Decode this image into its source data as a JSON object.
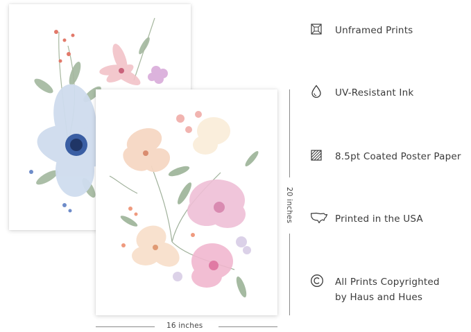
{
  "dimensions": {
    "width_label": "16 inches",
    "height_label": "20 inches"
  },
  "features": [
    {
      "icon": "unframed-icon",
      "lines": [
        "Unframed Prints"
      ]
    },
    {
      "icon": "ink-drop-icon",
      "lines": [
        "UV-Resistant Ink"
      ]
    },
    {
      "icon": "paper-texture-icon",
      "lines": [
        "8.5pt Coated Poster Paper"
      ]
    },
    {
      "icon": "usa-map-icon",
      "lines": [
        "Printed in the USA"
      ]
    },
    {
      "icon": "copyright-icon",
      "lines": [
        "All Prints Copyrighted",
        "by Haus and Hues"
      ]
    }
  ],
  "colors": {
    "text": "#3a3a3a",
    "dimension_line": "#8a8a8a"
  }
}
